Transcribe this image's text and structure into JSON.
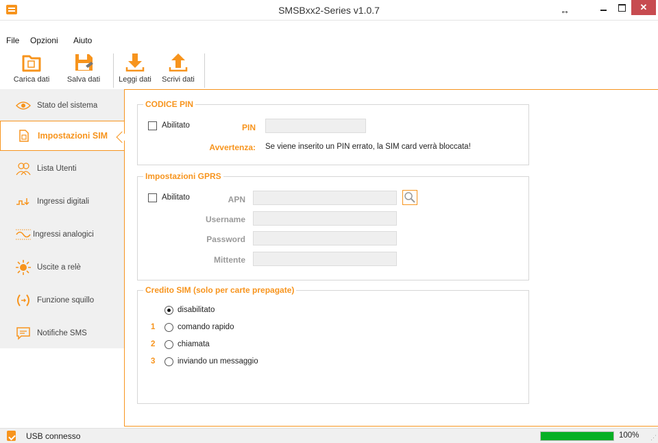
{
  "window": {
    "title": "SMSBxx2-Series v1.0.7"
  },
  "menu": [
    "File",
    "Opzioni",
    "Aiuto"
  ],
  "toolbar": {
    "load": "Carica dati",
    "save": "Salva dati",
    "read": "Leggi dati",
    "write": "Scrivi dati"
  },
  "sidebar": {
    "items": [
      {
        "label": "Stato del sistema",
        "icon": "eye-icon"
      },
      {
        "label": "Impostazioni SIM",
        "icon": "sim-card-icon"
      },
      {
        "label": "Lista Utenti",
        "icon": "users-icon"
      },
      {
        "label": "Ingressi digitali",
        "icon": "digital-input-icon"
      },
      {
        "label": "Ingressi analogici",
        "icon": "analog-input-icon"
      },
      {
        "label": "Uscite a relè",
        "icon": "relay-output-icon"
      },
      {
        "label": "Funzione squillo",
        "icon": "phone-ring-icon"
      },
      {
        "label": "Notifiche SMS",
        "icon": "sms-icon"
      }
    ],
    "active_index": 1
  },
  "pin": {
    "group_title": "CODICE PIN",
    "enabled_label": "Abilitato",
    "enabled": false,
    "pin_label": "PIN",
    "pin_value": "",
    "warning_label": "Avvertenza:",
    "warning_text": "Se viene inserito un PIN errato, la SIM card verrà bloccata!"
  },
  "gprs": {
    "group_title": "Impostazioni GPRS",
    "enabled_label": "Abilitato",
    "enabled": false,
    "apn_label": "APN",
    "apn_value": "",
    "username_label": "Username",
    "username_value": "",
    "password_label": "Password",
    "password_value": "",
    "sender_label": "Mittente",
    "sender_value": ""
  },
  "credit": {
    "group_title": "Credito SIM (solo per carte prepagate)",
    "options": [
      {
        "num": "",
        "label": "disabilitato",
        "selected": true
      },
      {
        "num": "1",
        "label": "comando rapido",
        "selected": false
      },
      {
        "num": "2",
        "label": "chiamata",
        "selected": false
      },
      {
        "num": "3",
        "label": "inviando un messaggio",
        "selected": false
      }
    ]
  },
  "status": {
    "text": "USB connesso",
    "progress_percent": 100,
    "progress_label": "100%"
  },
  "colors": {
    "accent": "#f7941d",
    "progress": "#06b025",
    "close": "#c74b50"
  }
}
